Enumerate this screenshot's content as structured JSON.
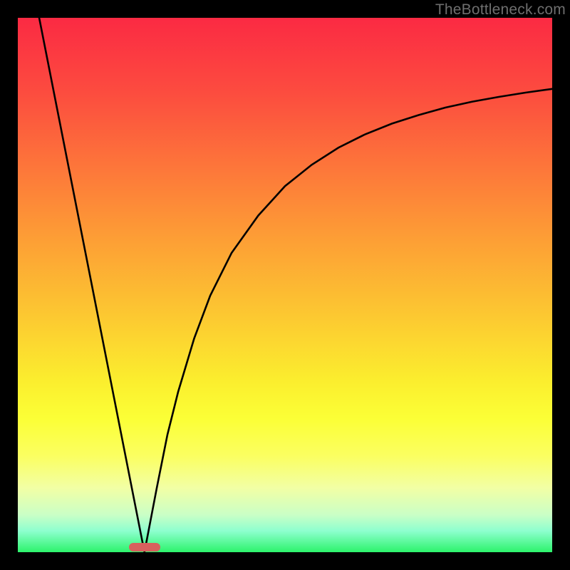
{
  "watermark": {
    "text": "TheBottleneck.com"
  },
  "chart_data": {
    "type": "line",
    "title": "",
    "xlabel": "",
    "ylabel": "",
    "xlim": [
      0,
      100
    ],
    "ylim": [
      0,
      100
    ],
    "grid": false,
    "legend": false,
    "background_gradient": {
      "direction": "vertical",
      "stops": [
        {
          "pos": 0.0,
          "color": "#fb2a43"
        },
        {
          "pos": 0.14,
          "color": "#fc4c3f"
        },
        {
          "pos": 0.28,
          "color": "#fd763a"
        },
        {
          "pos": 0.42,
          "color": "#fda035"
        },
        {
          "pos": 0.56,
          "color": "#fcc931"
        },
        {
          "pos": 0.68,
          "color": "#fbee2e"
        },
        {
          "pos": 0.75,
          "color": "#fbff36"
        },
        {
          "pos": 0.82,
          "color": "#fbff61"
        },
        {
          "pos": 0.88,
          "color": "#f2ffa5"
        },
        {
          "pos": 0.93,
          "color": "#caffc6"
        },
        {
          "pos": 0.96,
          "color": "#8effcf"
        },
        {
          "pos": 1.0,
          "color": "#2cf36b"
        }
      ]
    },
    "series": [
      {
        "name": "left-branch",
        "type": "line",
        "x": [
          4.0,
          23.7
        ],
        "y": [
          100.0,
          0.0
        ]
      },
      {
        "name": "right-branch",
        "type": "line",
        "x": [
          23.7,
          26,
          28,
          30,
          33,
          36,
          40,
          45,
          50,
          55,
          60,
          65,
          70,
          75,
          80,
          85,
          90,
          95,
          100
        ],
        "y": [
          0.0,
          12,
          22,
          30,
          40,
          48,
          56,
          63,
          68.5,
          72.5,
          75.7,
          78.2,
          80.2,
          81.8,
          83.2,
          84.3,
          85.2,
          86.0,
          86.7
        ]
      }
    ],
    "markers": [
      {
        "name": "bottleneck-pill",
        "shape": "pill",
        "x": 23.7,
        "y": 1.0,
        "color": "#d8605d"
      }
    ]
  }
}
